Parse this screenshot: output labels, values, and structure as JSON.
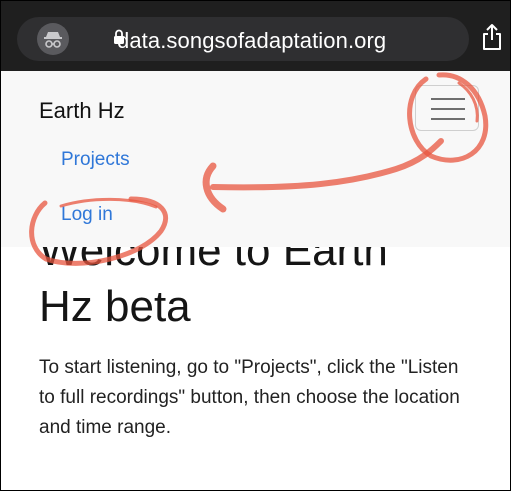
{
  "browser": {
    "url": "data.songsofadaptation.org",
    "icons": {
      "privacy": "incognito-icon",
      "lock": "lock-icon",
      "share": "share-icon"
    }
  },
  "navbar": {
    "brand": "Earth Hz",
    "toggle_icon": "hamburger-menu-icon",
    "links": [
      {
        "label": "Projects"
      },
      {
        "label": "Log in"
      }
    ]
  },
  "main": {
    "title_line_1": "Welcome to Earth",
    "title_line_2": "Hz beta",
    "intro": "To start listening, go to \"Projects\", click the \"Listen to full recordings\" button, then choose the location and time range."
  },
  "colors": {
    "browser_bg": "#1f1f1f",
    "navbar_bg": "#f8f8f8",
    "link": "#2f77d8",
    "annotation": "#e8553f"
  }
}
